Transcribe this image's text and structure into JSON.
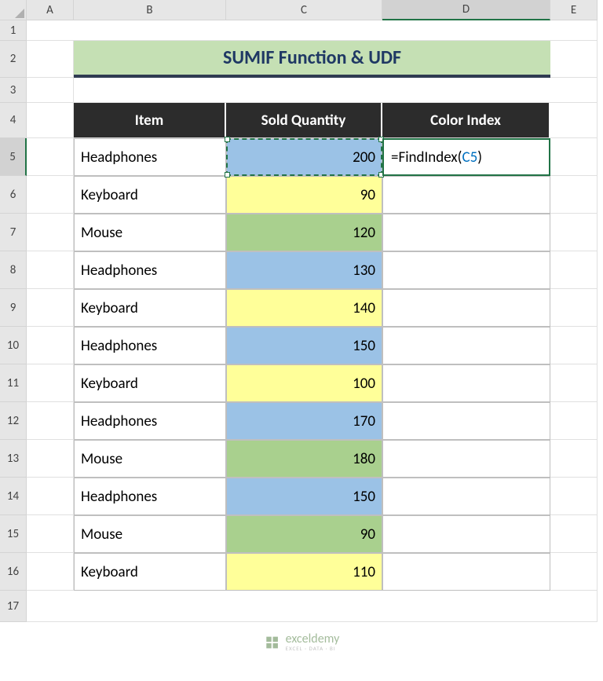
{
  "columns": [
    "A",
    "B",
    "C",
    "D",
    "E"
  ],
  "rows": [
    "1",
    "2",
    "3",
    "4",
    "5",
    "6",
    "7",
    "8",
    "9",
    "10",
    "11",
    "12",
    "13",
    "14",
    "15",
    "16",
    "17"
  ],
  "title": "SUMIF Function & UDF",
  "headers": {
    "item": "Item",
    "qty": "Sold Quantity",
    "idx": "Color Index"
  },
  "data": [
    {
      "item": "Headphones",
      "qty": "200",
      "color": "blue"
    },
    {
      "item": "Keyboard",
      "qty": "90",
      "color": "yellow"
    },
    {
      "item": "Mouse",
      "qty": "120",
      "color": "green"
    },
    {
      "item": "Headphones",
      "qty": "130",
      "color": "blue"
    },
    {
      "item": "Keyboard",
      "qty": "140",
      "color": "yellow"
    },
    {
      "item": "Headphones",
      "qty": "150",
      "color": "blue"
    },
    {
      "item": "Keyboard",
      "qty": "100",
      "color": "yellow"
    },
    {
      "item": "Headphones",
      "qty": "170",
      "color": "blue"
    },
    {
      "item": "Mouse",
      "qty": "180",
      "color": "green"
    },
    {
      "item": "Headphones",
      "qty": "150",
      "color": "blue"
    },
    {
      "item": "Mouse",
      "qty": "90",
      "color": "green"
    },
    {
      "item": "Keyboard",
      "qty": "110",
      "color": "yellow"
    }
  ],
  "formula": {
    "prefix": "=FindIndex(",
    "ref": "C5",
    "suffix": ")"
  },
  "selected_col": "D",
  "selected_row": "5",
  "watermark": {
    "brand": "exceldemy",
    "sub": "EXCEL · DATA · BI"
  }
}
